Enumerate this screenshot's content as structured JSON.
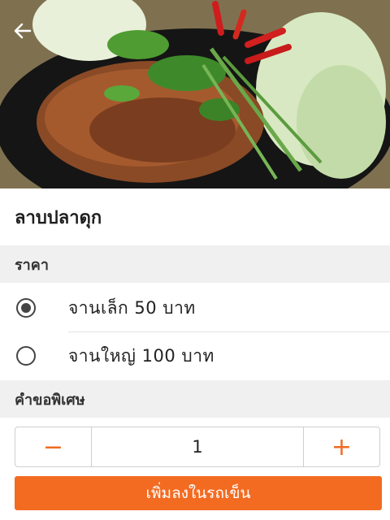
{
  "hero": {
    "image_description": "food-photo",
    "back_icon": "arrow-left-icon"
  },
  "dish": {
    "name": "ลาบปลาดุก"
  },
  "price_section": {
    "title": "ราคา",
    "options": [
      {
        "label": "จานเล็ก 50 บาท",
        "selected": true
      },
      {
        "label": "จานใหญ่ 100 บาท",
        "selected": false
      }
    ]
  },
  "special_request": {
    "title": "คำขอพิเศษ"
  },
  "quantity": {
    "minus": "−",
    "value": "1",
    "plus": "+"
  },
  "cart_button": {
    "label": "เพิ่มลงในรถเข็น"
  },
  "colors": {
    "accent": "#f36b21",
    "section_bg": "#f0f0f0"
  }
}
